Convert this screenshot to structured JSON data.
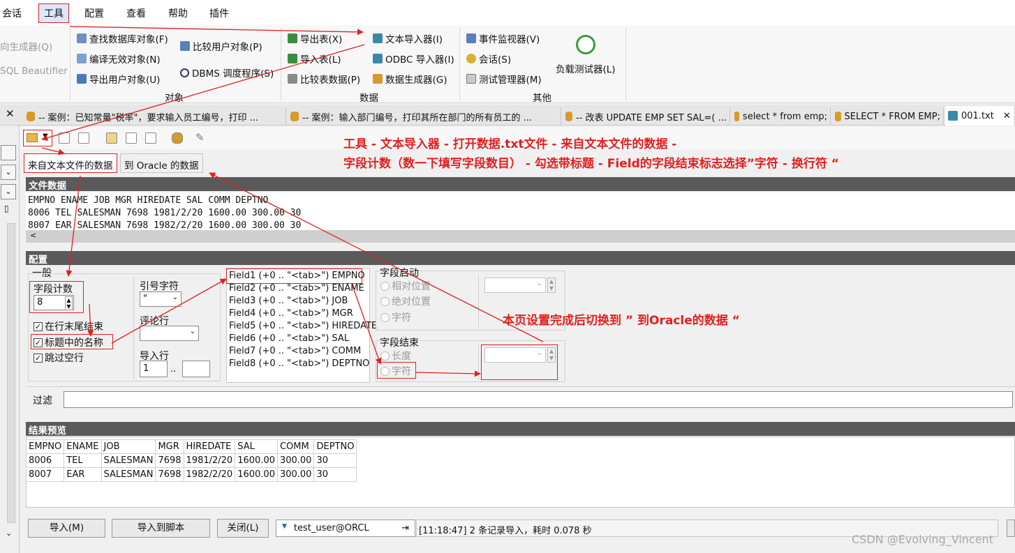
{
  "menu": [
    "会话",
    "工具",
    "配置",
    "查看",
    "帮助",
    "插件"
  ],
  "ribbon": {
    "left_items": [
      "向生成器(Q)",
      "SQL Beautifier"
    ],
    "objects": [
      "查找数据库对象(F)",
      "编译无效对象(N)",
      "导出用户对象(U)",
      "比较用户对象(P)",
      "DBMS 调度程序(S)"
    ],
    "objects_group": "对象",
    "data": [
      "导出表(X)",
      "导入表(L)",
      "比较表数据(P)",
      "文本导入器(I)",
      "ODBC 导入器(I)",
      "数据生成器(G)"
    ],
    "data_group": "数据",
    "other": [
      "事件监视器(V)",
      "会话(S)",
      "测试管理器(M)",
      "负载测试器(L)"
    ],
    "other_group": "其他"
  },
  "doc_tabs": [
    "-- 案例：已知常量\"税率\"，要求输入员工编号，打印 ...",
    "-- 案例：输入部门编号，打印其所在部门的所有员工的 ...",
    "-- 改表 UPDATE EMP SET SAL=( ...",
    "select * from emp;",
    "SELECT * FROM EMP;",
    "001.txt"
  ],
  "subtabs": [
    "来自文本文件的数据",
    "到 Oracle 的数据"
  ],
  "file_data": {
    "title": "文件数据",
    "lines": [
      "EMPNO ENAME JOB MGR HIREDATE SAL COMM DEPTNO",
      "8006 TEL SALESMAN 7698 1981/2/20 1600.00 300.00 30",
      "8007 EAR SALESMAN 7698 1982/2/20 1600.00 300.00 30"
    ]
  },
  "config": {
    "title": "配置",
    "general": "一般",
    "field_count_label": "字段计数",
    "field_count": "8",
    "checks": [
      "在行末尾结束",
      "标题中的名称",
      "跳过空行"
    ],
    "quote_label": "引号字符",
    "quote_value": "\"",
    "comment_label": "评论行",
    "import_row_label": "导入行",
    "import_from": "1",
    "import_sep": "..",
    "fields": [
      "Field1  (+0 .. \"<tab>\")  EMPNO",
      "Field2  (+0 .. \"<tab>\")  ENAME",
      "Field3  (+0 .. \"<tab>\")  JOB",
      "Field4  (+0 .. \"<tab>\")  MGR",
      "Field5  (+0 .. \"<tab>\")  HIREDATE",
      "Field6  (+0 .. \"<tab>\")  SAL",
      "Field7  (+0 .. \"<tab>\")  COMM",
      "Field8  (+0 .. \"<tab>\")  DEPTNO"
    ],
    "field_start": "字段启动",
    "start_opts": [
      "相对位置",
      "绝对位置",
      "字符"
    ],
    "field_end": "字段结束",
    "end_opts": [
      "长度",
      "字符"
    ],
    "filter_label": "过滤"
  },
  "annotations": {
    "line1": "工具 - 文本导入器 - 打开数据.txt文件 - 来自文本文件的数据 -",
    "line2": "字段计数（数一下填写字段数目） - 勾选带标题 - Field的字段结束标志选择”字符 - 换行符 “",
    "line3": "本页设置完成后切换到 ” 到Oracle的数据 “"
  },
  "results": {
    "title": "结果预览",
    "headers": [
      "EMPNO",
      "ENAME",
      "JOB",
      "MGR",
      "HIREDATE",
      "SAL",
      "COMM",
      "DEPTNO"
    ],
    "rows": [
      [
        "8006",
        "TEL",
        "SALESMAN",
        "7698",
        "1981/2/20",
        "1600.00",
        "300.00",
        "30"
      ],
      [
        "8007",
        "EAR",
        "SALESMAN",
        "7698",
        "1982/2/20",
        "1600.00",
        "300.00",
        "30"
      ]
    ]
  },
  "footer": {
    "import_btn": "导入(M)",
    "import_script_btn": "导入到脚本",
    "close_btn": "关闭(L)",
    "connection": "test_user@ORCL",
    "status": "[11:18:47]  2 条记录导入，耗时 0.078 秒",
    "watermark": "CSDN @Evolving_Vincent"
  },
  "colors": {
    "annotation": "#e21f1f",
    "section_bar": "#5a5a5a"
  }
}
